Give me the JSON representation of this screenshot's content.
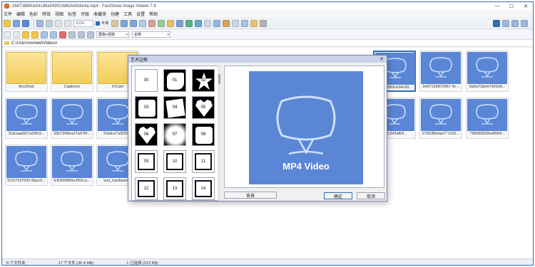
{
  "window": {
    "title": "2b873889cb34c99a049f2cb8b3e9d3e4a.mp4 - FastStone Image Viewer 7.6",
    "controls": [
      "—",
      "☐",
      "✕"
    ]
  },
  "menu": {
    "items": [
      "文件",
      "编辑",
      "色彩",
      "特效",
      "视图",
      "标签",
      "评级",
      "收藏夹",
      "创建",
      "工具",
      "设置",
      "帮助"
    ]
  },
  "toolbar": {
    "zoom_value": "110%",
    "smooth_label": "平滑"
  },
  "toolbar2": {
    "view_combo": "图像+视频",
    "sort_combo": "名称"
  },
  "path": {
    "value": "C:\\Users\\renwei\\Videos\\"
  },
  "grid": {
    "row1": [
      "AnyDesk",
      "Captures",
      "iVCam",
      "",
      "",
      "",
      "",
      "",
      "2b873889cb34c99...",
      "2e87150873457 4c...",
      "9a6a73de67420e8..."
    ],
    "row2": [
      "11dcaaa507a20fc9...",
      "33b7349ea27a07f4...",
      "53afce7a3559...",
      "",
      "",
      "",
      "",
      "",
      "c7cc343af59...",
      "678188efaa77 61f2...",
      "768980028a4f904..."
    ],
    "row3": [
      "f2167197530 5bac0...",
      "fc83656fb5e2f02ca...",
      "test_hardware...",
      "",
      "",
      "",
      "",
      "",
      "",
      "",
      ""
    ],
    "video_label": "MP4 Video"
  },
  "status": {
    "folders": "8 个文件夹",
    "files": "17 个文件 (36.4 MB)",
    "selected": "1 已选择 (513 KB)"
  },
  "dialog": {
    "title": "艺术边框",
    "close": "✕",
    "masks": [
      "00",
      "01",
      "02",
      "03",
      "04",
      "05",
      "06",
      "07",
      "08",
      "09",
      "10",
      "11",
      "12",
      "13",
      "14"
    ],
    "preview_text": "MP4 Video",
    "bg_button": "背景",
    "ok_button": "确定",
    "cancel_button": "取消"
  },
  "colors": {
    "accent": "#2f6fb5",
    "video_thumb": "#5b86d6",
    "folder": "#f2cd5a"
  }
}
